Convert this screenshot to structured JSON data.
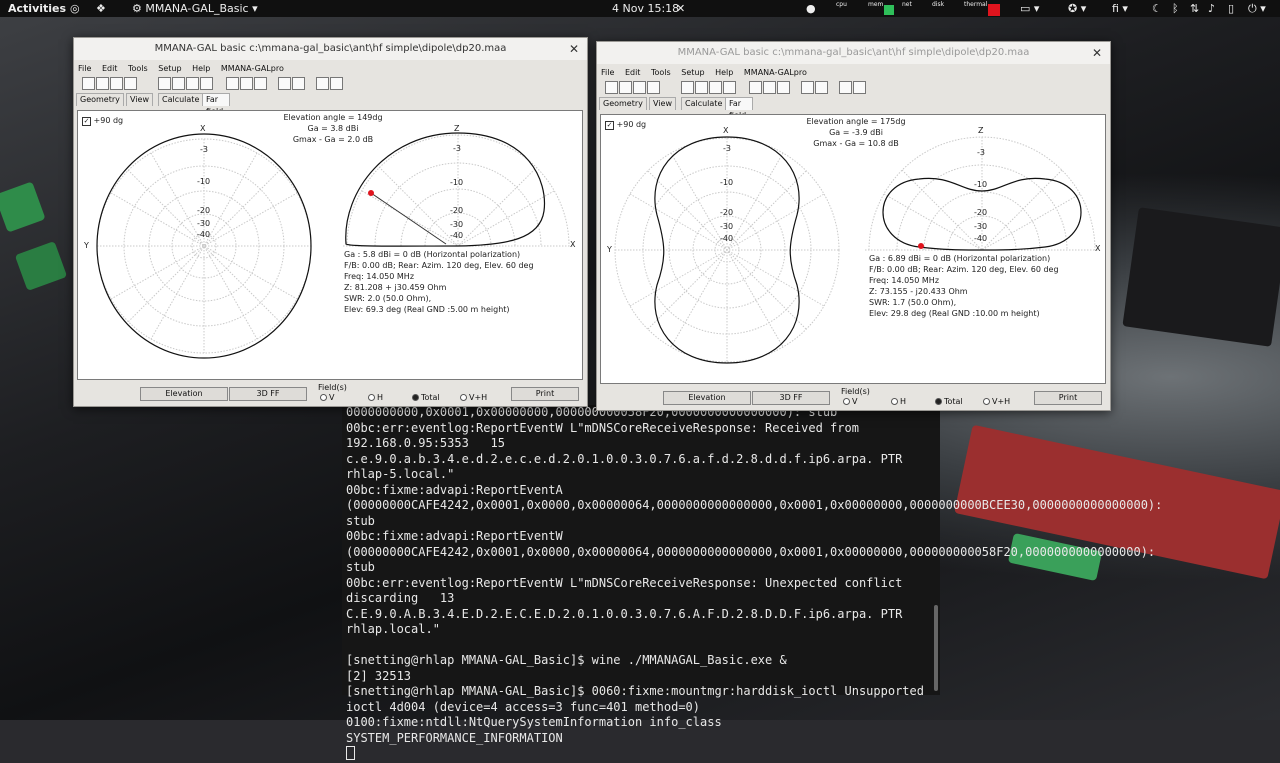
{
  "topbar": {
    "activities": "Activities",
    "app_name": "MMANA-GAL_Basic",
    "clock": "4 Nov  15:18",
    "tray_labels": [
      "cpu",
      "mem",
      "net",
      "disk",
      "thermal"
    ],
    "lang": "fi"
  },
  "window_left": {
    "title": "MMANA-GAL basic c:\\mmana-gal_basic\\ant\\hf simple\\dipole\\dp20.maa",
    "menu": [
      "File",
      "Edit",
      "Tools",
      "Setup",
      "Help",
      "MMANA-GALpro"
    ],
    "tabs": [
      "Geometry",
      "View",
      "Calculate",
      "Far field plots"
    ],
    "checkbox_label": "+90 dg",
    "elevation_angle": "Elevation angle = 149dg",
    "ga": "Ga = 3.8 dBi",
    "gmax": "Gmax - Ga = 2.0 dB",
    "scale_labels": [
      "-3",
      "-10",
      "-20",
      "-30",
      "-40"
    ],
    "axis": {
      "x": "X",
      "y": "Y",
      "z": "Z"
    },
    "info": [
      "Ga : 5.8 dBi = 0 dB  (Horizontal polarization)",
      "F/B: 0.00 dB; Rear: Azim. 120 deg,  Elev. 60 deg",
      "Freq: 14.050 MHz",
      "Z: 81.208 + j30.459 Ohm",
      "SWR: 2.0 (50.0 Ohm),",
      "Elev: 69.3 deg (Real GND  :5.00 m height)"
    ],
    "buttons": {
      "elevation": "Elevation",
      "ff3d": "3D FF",
      "print": "Print"
    },
    "field_label": "Field(s)",
    "field_options": [
      "V",
      "H",
      "Total",
      "V+H"
    ]
  },
  "window_right": {
    "title": "MMANA-GAL basic c:\\mmana-gal_basic\\ant\\hf simple\\dipole\\dp20.maa",
    "menu": [
      "File",
      "Edit",
      "Tools",
      "Setup",
      "Help",
      "MMANA-GALpro"
    ],
    "tabs": [
      "Geometry",
      "View",
      "Calculate",
      "Far field plots"
    ],
    "checkbox_label": "+90 dg",
    "elevation_angle": "Elevation angle = 175dg",
    "ga": "Ga = -3.9 dBi",
    "gmax": "Gmax - Ga = 10.8 dB",
    "scale_labels": [
      "-3",
      "-10",
      "-20",
      "-30",
      "-40"
    ],
    "axis": {
      "x": "X",
      "y": "Y",
      "z": "Z"
    },
    "info": [
      "Ga : 6.89 dBi = 0 dB  (Horizontal polarization)",
      "F/B: 0.00 dB; Rear: Azim. 120 deg,  Elev. 60 deg",
      "Freq: 14.050 MHz",
      "Z: 73.155 - j20.433 Ohm",
      "SWR: 1.7 (50.0 Ohm),",
      "Elev: 29.8 deg (Real GND  :10.00 m height)"
    ],
    "buttons": {
      "elevation": "Elevation",
      "ff3d": "3D FF",
      "print": "Print"
    },
    "field_label": "Field(s)",
    "field_options": [
      "V",
      "H",
      "Total",
      "V+H"
    ]
  },
  "terminal": {
    "lines": [
      "0000000000,0x0001,0x00000000,000000000058F20,0000000000000000): stub",
      "00bc:err:eventlog:ReportEventW L\"mDNSCoreReceiveResponse: Received from 192.168.0.95:5353   15 c.e.9.0.a.b.3.4.e.d.2.e.c.e.d.2.0.1.0.0.3.0.7.6.a.f.d.2.8.d.d.f.ip6.arpa. PTR rhlap-5.local.\"",
      "00bc:fixme:advapi:ReportEventA (00000000CAFE4242,0x0001,0x0000,0x00000064,0000000000000000,0x0001,0x00000000,0000000000BCEE30,0000000000000000): stub",
      "00bc:fixme:advapi:ReportEventW (00000000CAFE4242,0x0001,0x0000,0x00000064,0000000000000000,0x0001,0x00000000,000000000058F20,0000000000000000): stub",
      "00bc:err:eventlog:ReportEventW L\"mDNSCoreReceiveResponse: Unexpected conflict discarding   13 C.E.9.0.A.B.3.4.E.D.2.E.C.E.D.2.0.1.0.0.3.0.7.6.A.F.D.2.8.D.D.F.ip6.arpa. PTR rhlap.local.\"",
      "",
      "[snetting@rhlap MMANA-GAL_Basic]$ wine ./MMANAGAL_Basic.exe &",
      "[2] 32513",
      "[snetting@rhlap MMANA-GAL_Basic]$ 0060:fixme:mountmgr:harddisk_ioctl Unsupported ioctl 4d004 (device=4 access=3 func=401 method=0)",
      "0100:fixme:ntdll:NtQuerySystemInformation info_class SYSTEM_PERFORMANCE_INFORMATION"
    ]
  }
}
